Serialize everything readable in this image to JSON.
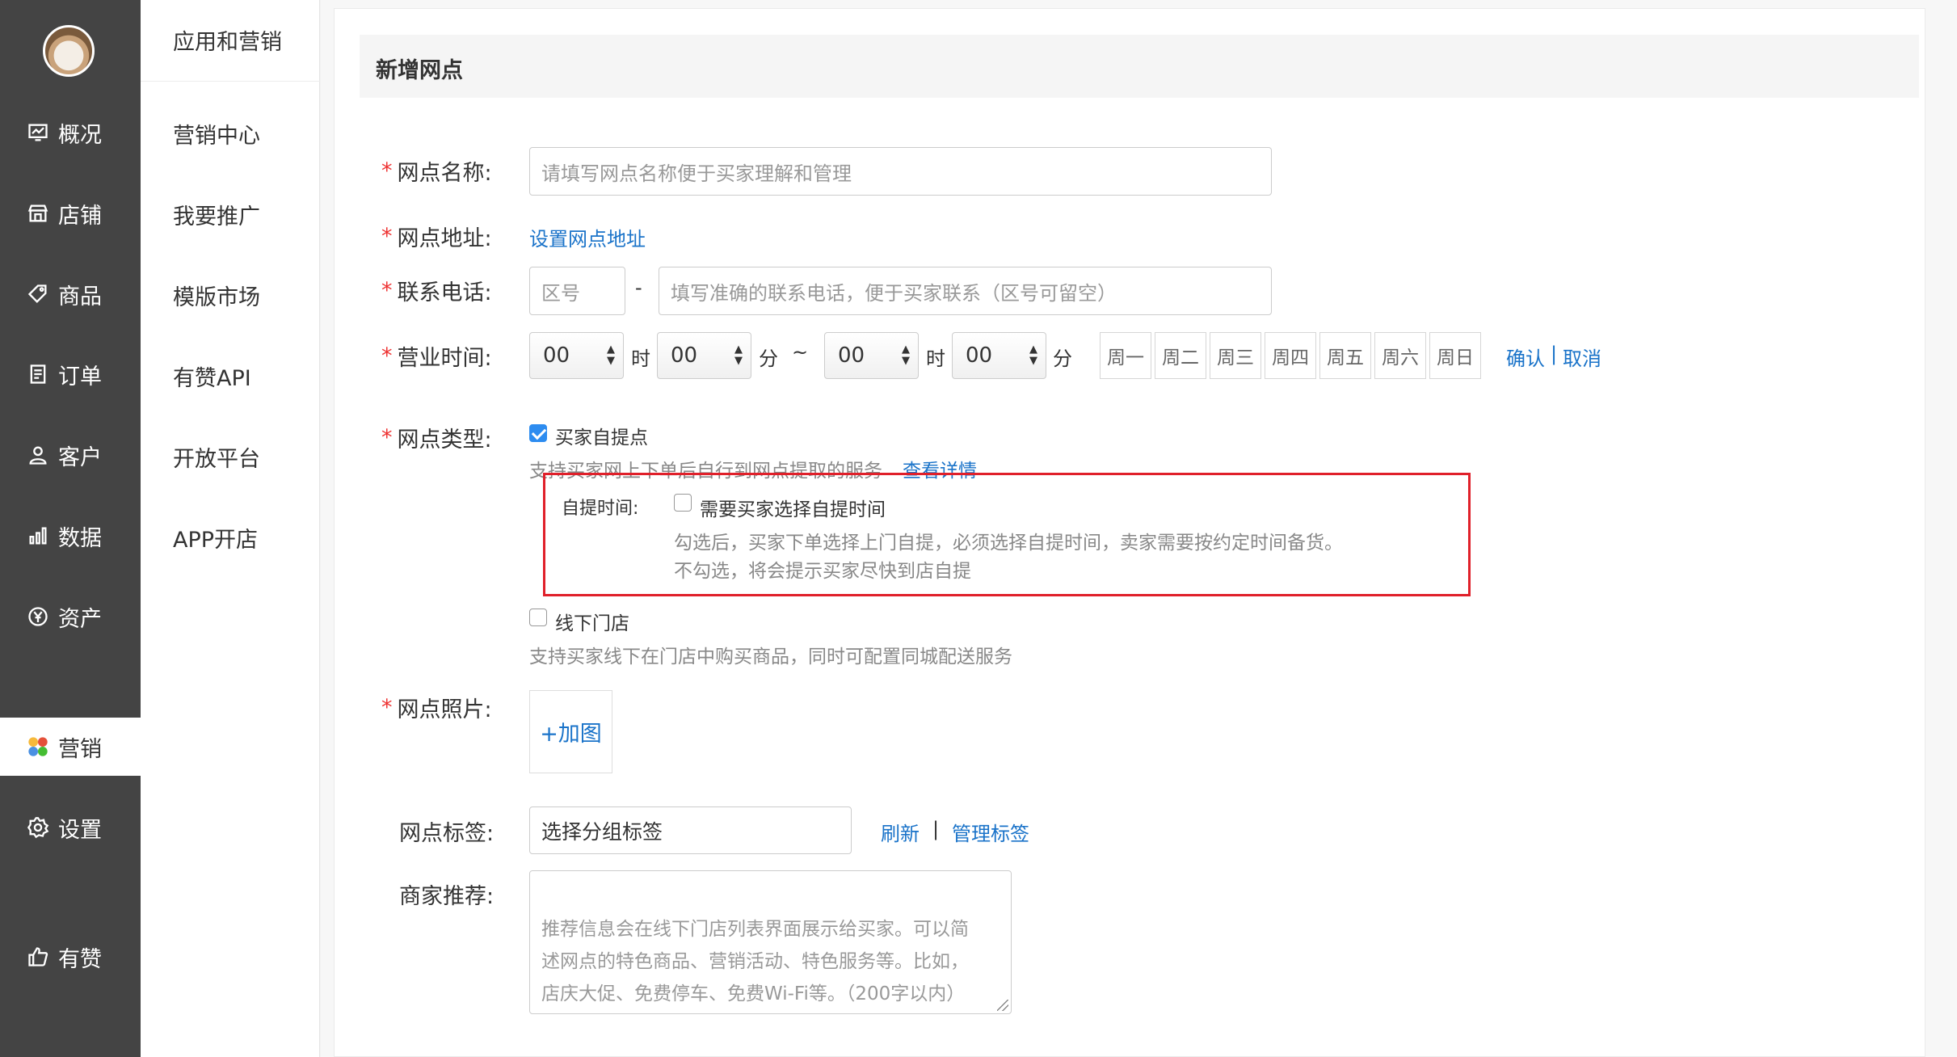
{
  "nav": {
    "items": [
      {
        "label": "概况",
        "icon": "overview-icon"
      },
      {
        "label": "店铺",
        "icon": "store-icon"
      },
      {
        "label": "商品",
        "icon": "tag-icon"
      },
      {
        "label": "订单",
        "icon": "order-icon"
      },
      {
        "label": "客户",
        "icon": "user-icon"
      },
      {
        "label": "数据",
        "icon": "bar-chart-icon"
      },
      {
        "label": "资产",
        "icon": "yen-icon"
      },
      {
        "label": "营销",
        "icon": "apps-icon",
        "active": true
      },
      {
        "label": "设置",
        "icon": "gear-icon"
      },
      {
        "label": "有赞",
        "icon": "thumbs-up-icon"
      }
    ]
  },
  "subnav": {
    "title": "应用和营销",
    "items": [
      "营销中心",
      "我要推广",
      "模版市场",
      "有赞API",
      "开放平台",
      "APP开店"
    ]
  },
  "page": {
    "title": "新增网点"
  },
  "form": {
    "name": {
      "label": "网点名称:",
      "placeholder": "请填写网点名称便于买家理解和管理"
    },
    "address": {
      "label": "网点地址:",
      "link": "设置网点地址"
    },
    "phone": {
      "label": "联系电话:",
      "area_placeholder": "区号",
      "dash": "-",
      "number_placeholder": "填写准确的联系电话，便于买家联系（区号可留空）"
    },
    "hours": {
      "label": "营业时间:",
      "start_hour": "00",
      "hour_unit": "时",
      "start_min": "00",
      "min_unit": "分",
      "tilde": "~",
      "end_hour": "00",
      "end_min": "00",
      "days": [
        "周一",
        "周二",
        "周三",
        "周四",
        "周五",
        "周六",
        "周日"
      ],
      "confirm": "确认",
      "divider": "|",
      "cancel": "取消"
    },
    "type": {
      "label": "网点类型:",
      "pickup": {
        "label": "买家自提点",
        "checked": true,
        "desc": "支持买家网上下单后自行到网点提取的服务",
        "detail_link": "查看详情"
      },
      "pickup_time": {
        "label": "自提时间:",
        "checkbox_label": "需要买家选择自提时间",
        "checked": false,
        "hint1": "勾选后，买家下单选择上门自提，必须选择自提时间，卖家需要按约定时间备货。",
        "hint2": "不勾选，将会提示买家尽快到店自提"
      },
      "offline": {
        "label": "线下门店",
        "checked": false,
        "desc": "支持买家线下在门店中购买商品，同时可配置同城配送服务"
      }
    },
    "photo": {
      "label": "网点照片:",
      "add": "+加图"
    },
    "tags": {
      "label": "网点标签:",
      "value": "选择分组标签",
      "refresh": "刷新",
      "divider": "|",
      "manage": "管理标签"
    },
    "recommend": {
      "label": "商家推荐:",
      "placeholder": "推荐信息会在线下门店列表界面展示给买家。可以简\n述网点的特色商品、营销活动、特色服务等。比如，\n店庆大促、免费停车、免费Wi-Fi等。（200字以内）"
    }
  },
  "colors": {
    "accent": "#1a73c9",
    "required": "#e33333",
    "highlight_box": "#e0202a",
    "sidebar": "#444444"
  }
}
